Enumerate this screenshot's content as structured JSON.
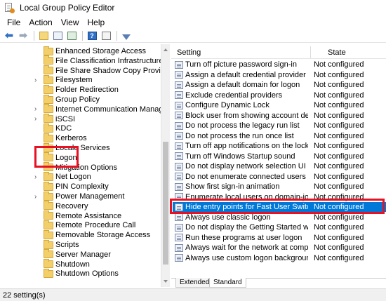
{
  "window": {
    "title": "Local Group Policy Editor"
  },
  "menu": [
    "File",
    "Action",
    "View",
    "Help"
  ],
  "toolbar": {
    "buttons": [
      "back-icon",
      "forward-icon",
      "up-folder-icon",
      "show-hide-tree-icon",
      "export-list-icon",
      "help-icon",
      "properties-icon",
      "filter-icon"
    ]
  },
  "tree": {
    "items": [
      {
        "label": "Enhanced Storage Access",
        "expandable": false
      },
      {
        "label": "File Classification Infrastructure",
        "expandable": false
      },
      {
        "label": "File Share Shadow Copy Provider",
        "expandable": false
      },
      {
        "label": "Filesystem",
        "expandable": true
      },
      {
        "label": "Folder Redirection",
        "expandable": false
      },
      {
        "label": "Group Policy",
        "expandable": false
      },
      {
        "label": "Internet Communication Manageme",
        "expandable": true
      },
      {
        "label": "iSCSI",
        "expandable": true
      },
      {
        "label": "KDC",
        "expandable": false
      },
      {
        "label": "Kerberos",
        "expandable": false
      },
      {
        "label": "Locale Services",
        "expandable": false
      },
      {
        "label": "Logon",
        "expandable": false
      },
      {
        "label": "Mitigation Options",
        "expandable": false
      },
      {
        "label": "Net Logon",
        "expandable": true
      },
      {
        "label": "PIN Complexity",
        "expandable": false
      },
      {
        "label": "Power Management",
        "expandable": true
      },
      {
        "label": "Recovery",
        "expandable": false
      },
      {
        "label": "Remote Assistance",
        "expandable": false
      },
      {
        "label": "Remote Procedure Call",
        "expandable": false
      },
      {
        "label": "Removable Storage Access",
        "expandable": false
      },
      {
        "label": "Scripts",
        "expandable": false
      },
      {
        "label": "Server Manager",
        "expandable": false
      },
      {
        "label": "Shutdown",
        "expandable": false
      },
      {
        "label": "Shutdown Options",
        "expandable": false
      }
    ]
  },
  "list": {
    "columns": {
      "setting": "Setting",
      "state": "State"
    },
    "rows": [
      {
        "setting": "Turn off picture password sign-in",
        "state": "Not configured",
        "selected": false
      },
      {
        "setting": "Assign a default credential provider",
        "state": "Not configured",
        "selected": false
      },
      {
        "setting": "Assign a default domain for logon",
        "state": "Not configured",
        "selected": false
      },
      {
        "setting": "Exclude credential providers",
        "state": "Not configured",
        "selected": false
      },
      {
        "setting": "Configure Dynamic Lock",
        "state": "Not configured",
        "selected": false
      },
      {
        "setting": "Block user from showing account details ...",
        "state": "Not configured",
        "selected": false
      },
      {
        "setting": "Do not process the legacy run list",
        "state": "Not configured",
        "selected": false
      },
      {
        "setting": "Do not process the run once list",
        "state": "Not configured",
        "selected": false
      },
      {
        "setting": "Turn off app notifications on the lock scr...",
        "state": "Not configured",
        "selected": false
      },
      {
        "setting": "Turn off Windows Startup sound",
        "state": "Not configured",
        "selected": false
      },
      {
        "setting": "Do not display network selection UI",
        "state": "Not configured",
        "selected": false
      },
      {
        "setting": "Do not enumerate connected users on do...",
        "state": "Not configured",
        "selected": false
      },
      {
        "setting": "Show first sign-in animation",
        "state": "Not configured",
        "selected": false
      },
      {
        "setting": "Enumerate local users on domain-joined ...",
        "state": "Not configured",
        "selected": false
      },
      {
        "setting": "Hide entry points for Fast User Switching",
        "state": "Not configured",
        "selected": true
      },
      {
        "setting": "Always use classic logon",
        "state": "Not configured",
        "selected": false
      },
      {
        "setting": "Do not display the Getting Started welco...",
        "state": "Not configured",
        "selected": false
      },
      {
        "setting": "Run these programs at user logon",
        "state": "Not configured",
        "selected": false
      },
      {
        "setting": "Always wait for the network at computer ...",
        "state": "Not configured",
        "selected": false
      },
      {
        "setting": "Always use custom logon background",
        "state": "Not configured",
        "selected": false
      }
    ]
  },
  "tabs": [
    {
      "label": "Extended",
      "active": false
    },
    {
      "label": "Standard",
      "active": true
    }
  ],
  "status": "22 setting(s)",
  "colors": {
    "selection": "#0078d7",
    "annotation": "#e81123",
    "folder": "#f2cf6b"
  }
}
